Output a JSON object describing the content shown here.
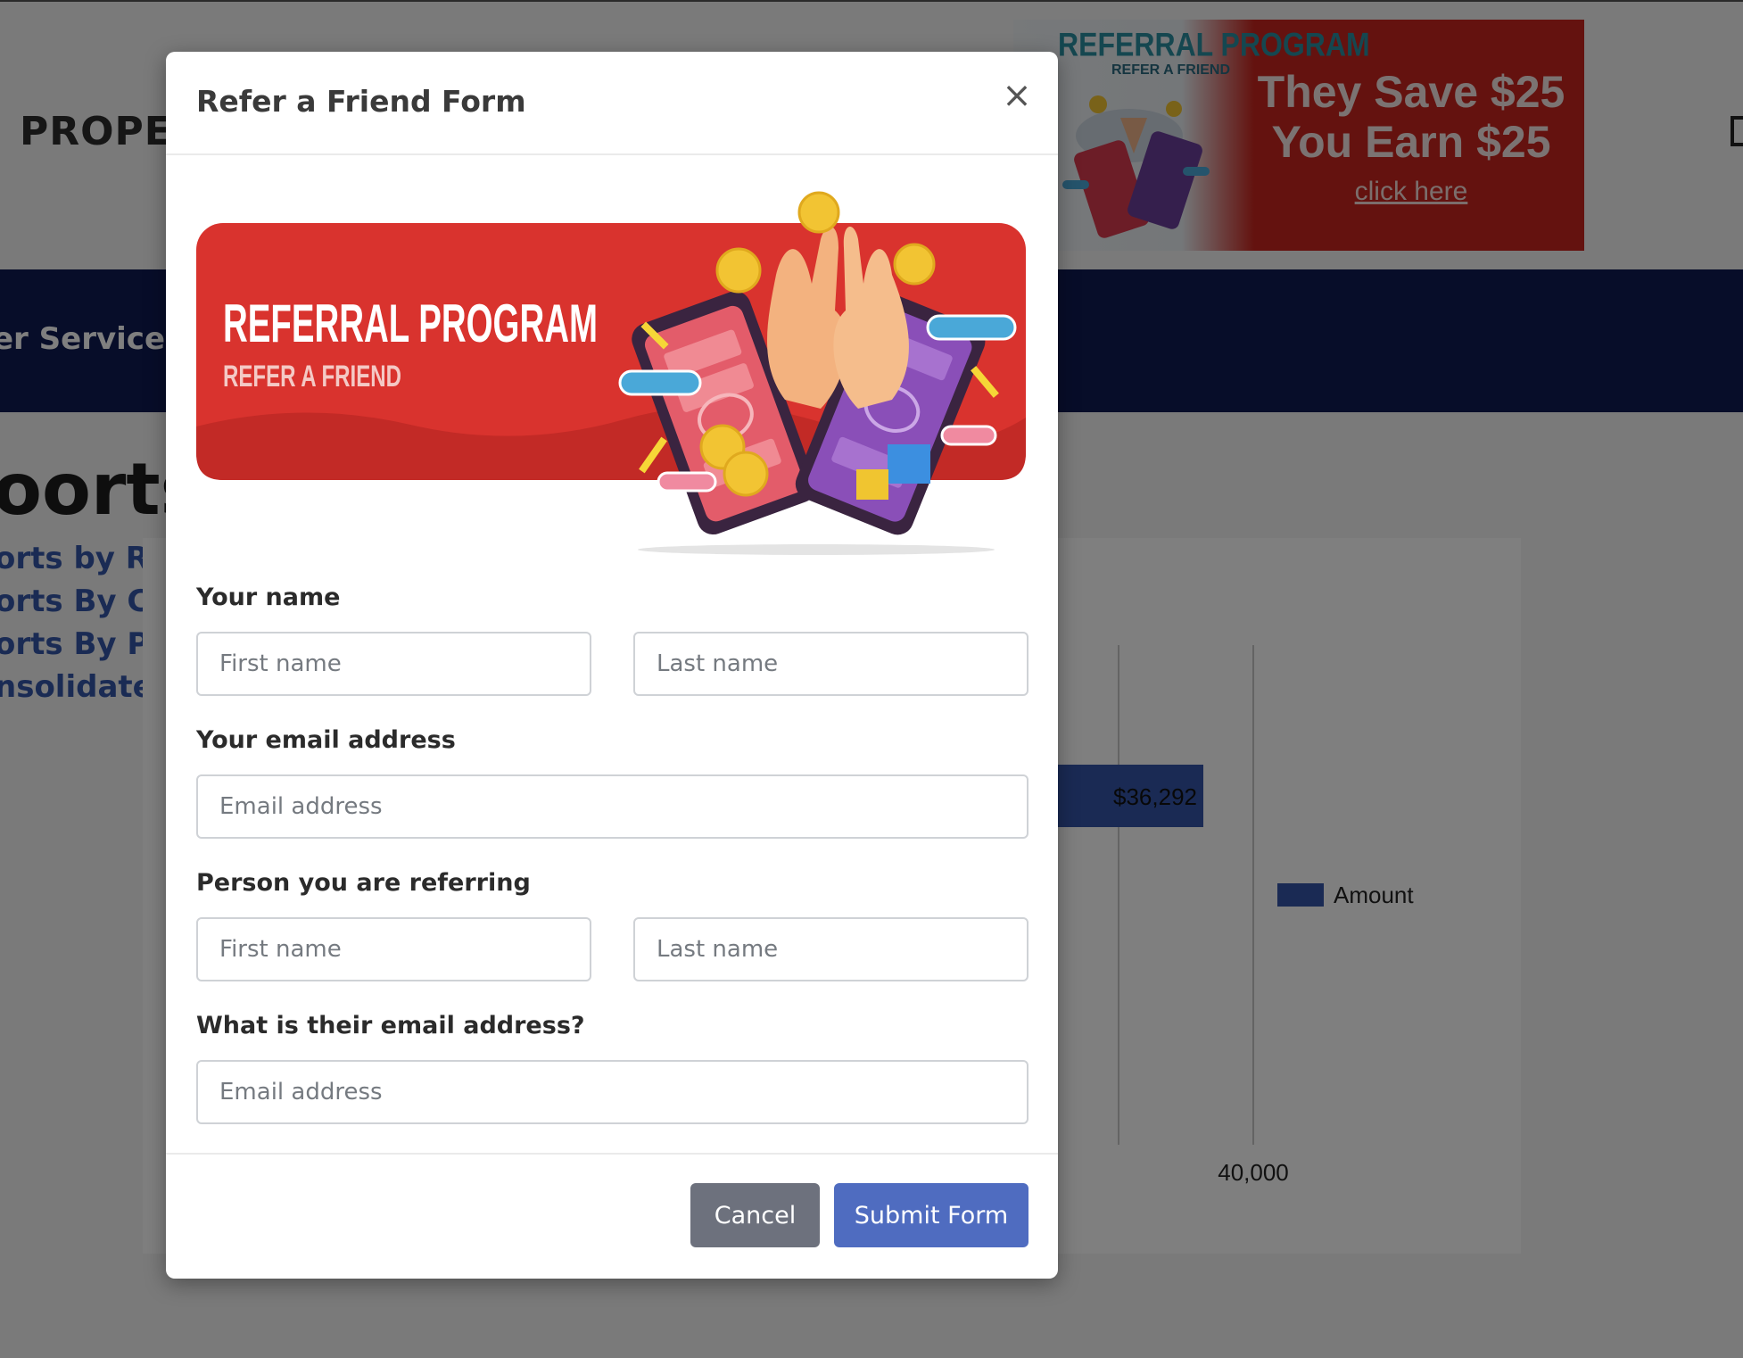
{
  "page": {
    "brand": "PROPER",
    "promo": {
      "title": "REFERRAL PROGRAM",
      "subtitle": "REFER A FRIEND",
      "line1": "They Save $25",
      "line2": "You Earn $25",
      "link": "click here",
      "colors": {
        "background": "#c8251e",
        "title": "#2a8ea0"
      }
    },
    "nav": {
      "item": "er Services",
      "background": "#0e1a52"
    },
    "title": "oorts",
    "side_links": [
      "orts by Roo",
      "orts By Cate",
      "orts By Prop",
      "nsolidated R"
    ]
  },
  "chart_data": {
    "type": "bar",
    "orientation": "horizontal",
    "series": [
      {
        "name": "Amount",
        "values": [
          36292
        ]
      }
    ],
    "data_labels": [
      "$36,292"
    ],
    "x_tick_labels": [
      "40,000"
    ],
    "legend": "right",
    "grid": true,
    "color": "#3555a8"
  },
  "modal": {
    "title": "Refer a Friend Form",
    "close_glyph": "×",
    "banner": {
      "title": "REFERRAL PROGRAM",
      "subtitle": "REFER A FRIEND"
    },
    "your_name": {
      "label": "Your name",
      "first_placeholder": "First name",
      "last_placeholder": "Last name"
    },
    "your_email": {
      "label": "Your email address",
      "placeholder": "Email address"
    },
    "referral_name": {
      "label": "Person you are referring",
      "first_placeholder": "First name",
      "last_placeholder": "Last name"
    },
    "referral_email": {
      "label": "What is their email address?",
      "placeholder": "Email address"
    },
    "cancel_label": "Cancel",
    "submit_label": "Submit Form",
    "colors": {
      "submit": "#4f6cc0",
      "cancel": "#6d717d",
      "banner": "#d9332e"
    }
  }
}
